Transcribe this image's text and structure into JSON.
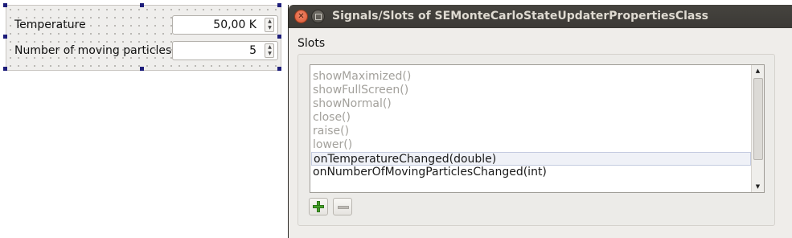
{
  "form": {
    "rows": [
      {
        "label": "Temperature",
        "value": "50,00 K"
      },
      {
        "label": "Number of moving particles",
        "value": "5"
      }
    ]
  },
  "dialog": {
    "title": "Signals/Slots of SEMonteCarloStateUpdaterPropertiesClass",
    "group_title": "Slots",
    "slots": [
      {
        "label": "showMaximized()",
        "state": "disabled"
      },
      {
        "label": "showFullScreen()",
        "state": "disabled"
      },
      {
        "label": "showNormal()",
        "state": "disabled"
      },
      {
        "label": "close()",
        "state": "disabled"
      },
      {
        "label": "raise()",
        "state": "disabled"
      },
      {
        "label": "lower()",
        "state": "disabled"
      },
      {
        "label": "onTemperatureChanged(double)",
        "state": "selected"
      },
      {
        "label": "onNumberOfMovingParticlesChanged(int)",
        "state": "normal"
      }
    ],
    "buttons": {
      "add_icon": "plus-icon",
      "remove_icon": "minus-icon"
    }
  },
  "colors": {
    "titlebar": "#3b3935",
    "close_button": "#e0592f",
    "disabled_text": "#a3a19c",
    "add_icon": "#45a12a"
  }
}
